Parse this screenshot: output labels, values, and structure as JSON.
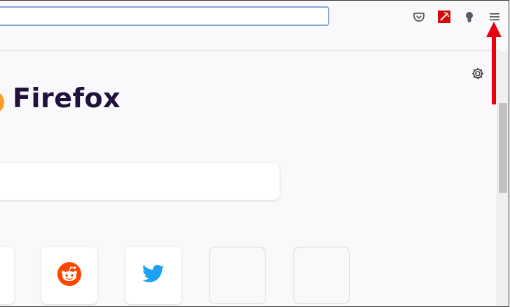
{
  "app": {
    "title": "Firefox",
    "url_value": ""
  },
  "toolbar": {
    "icons": [
      "pocket-icon",
      "extension-icon",
      "lightbulb-extension-icon",
      "hamburger-menu-icon"
    ]
  },
  "newtab": {
    "brand": "Firefox",
    "settings_icon": "gear-icon",
    "search_placeholder": ""
  },
  "top_sites": [
    {
      "name": "",
      "icon": "partial-tile"
    },
    {
      "name": "",
      "icon": "reddit-icon"
    },
    {
      "name": "",
      "icon": "twitter-icon"
    },
    {
      "name": "",
      "icon": "empty"
    },
    {
      "name": "",
      "icon": "empty"
    }
  ],
  "annotation": {
    "color": "#e8000f",
    "target": "hamburger-menu-icon"
  }
}
